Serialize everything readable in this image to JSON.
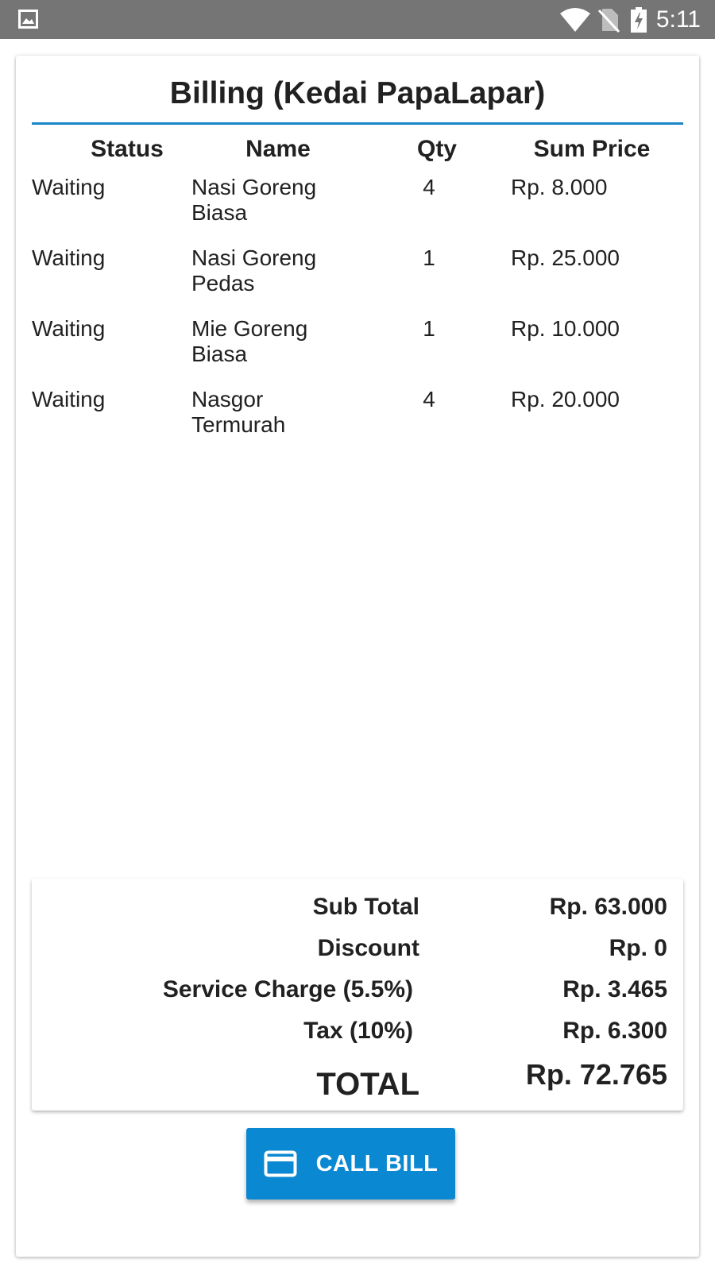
{
  "status_bar": {
    "time": "5:11",
    "icons": [
      "image-icon",
      "wifi-icon",
      "no-sim-icon",
      "battery-charging-icon"
    ]
  },
  "billing": {
    "title": "Billing (Kedai PapaLapar)",
    "headers": {
      "status": "Status",
      "name": "Name",
      "qty": "Qty",
      "sum_price": "Sum Price"
    },
    "rows": [
      {
        "status": "Waiting",
        "name": "Nasi Goreng Biasa",
        "qty": "4",
        "sum_price": "Rp. 8.000"
      },
      {
        "status": "Waiting",
        "name": "Nasi Goreng Pedas",
        "qty": "1",
        "sum_price": "Rp. 25.000"
      },
      {
        "status": "Waiting",
        "name": "Mie Goreng Biasa",
        "qty": "1",
        "sum_price": "Rp. 10.000"
      },
      {
        "status": "Waiting",
        "name": "Nasgor Termurah",
        "qty": "4",
        "sum_price": "Rp. 20.000"
      }
    ]
  },
  "summary": {
    "sub_total_label": "Sub Total",
    "sub_total_value": "Rp. 63.000",
    "discount_label": "Discount",
    "discount_value": "Rp. 0",
    "service_label": "Service Charge (5.5%)",
    "service_value": "Rp. 3.465",
    "tax_label": "Tax (10%)",
    "tax_value": "Rp. 6.300",
    "total_label": "TOTAL",
    "total_value": "Rp. 72.765"
  },
  "actions": {
    "call_bill_label": "CALL BILL",
    "call_bill_icon": "credit-card-icon"
  },
  "colors": {
    "status_bar": "#757575",
    "accent": "#1a84c7",
    "button": "#0a88d1"
  }
}
